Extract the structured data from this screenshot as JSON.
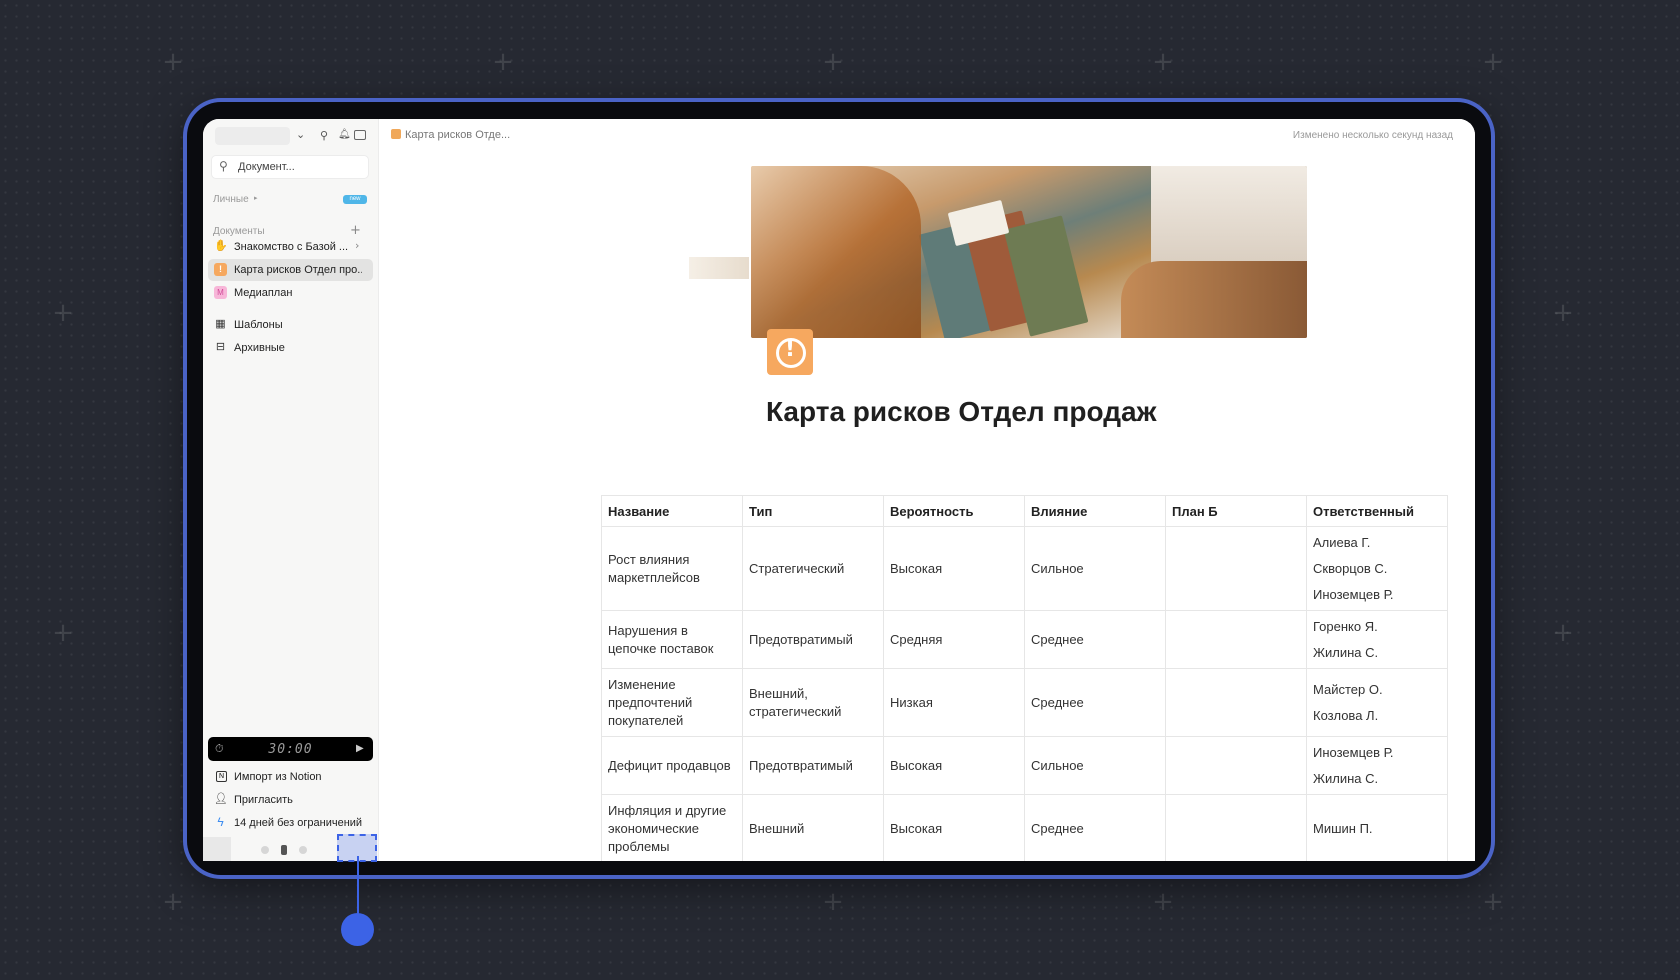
{
  "sidebar": {
    "search_placeholder": "Документ...",
    "personal_label": "Личные",
    "personal_badge": "new",
    "docs_label": "Документы",
    "items": [
      {
        "label": "Знакомство с Базой ...",
        "icon": "waving-hand-icon"
      },
      {
        "label": "Карта рисков Отдел про...",
        "icon": "alert-icon"
      },
      {
        "label": "Медиаплан",
        "icon": "m-letter-icon"
      }
    ],
    "templates_label": "Шаблоны",
    "archive_label": "Архивные",
    "timer": "30:00",
    "bottom_items": [
      {
        "label": "Импорт из Notion",
        "icon": "notion-icon"
      },
      {
        "label": "Пригласить",
        "icon": "add-user-icon"
      },
      {
        "label": "14 дней без ограничений",
        "icon": "lightning-icon"
      }
    ]
  },
  "page": {
    "breadcrumb": "Карта рисков Отде...",
    "edited": "Изменено несколько секунд назад",
    "title": "Карта рисков Отдел продаж",
    "accent": "#f6a85f"
  },
  "table": {
    "headers": [
      "Название",
      "Тип",
      "Вероятность",
      "Влияние",
      "План Б",
      "Ответственный"
    ],
    "rows": [
      {
        "name": "Рост влияния маркетплейсов",
        "type": "Стратегический",
        "prob": "Высокая",
        "impact": "Сильное",
        "plan": "",
        "owners": [
          "Алиева Г.",
          "Скворцов С.",
          "Иноземцев Р."
        ]
      },
      {
        "name": "Нарушения в цепочке поставок",
        "type": "Предотвратимый",
        "prob": "Средняя",
        "impact": "Среднее",
        "plan": "",
        "owners": [
          "Горенко Я.",
          "Жилина С."
        ]
      },
      {
        "name": "Изменение предпочтений покупателей",
        "type": "Внешний, стратегический",
        "prob": "Низкая",
        "impact": "Среднее",
        "plan": "",
        "owners": [
          "Майстер О.",
          "Козлова Л."
        ]
      },
      {
        "name": "Дефицит продавцов",
        "type": "Предотвратимый",
        "prob": "Высокая",
        "impact": "Сильное",
        "plan": "",
        "owners": [
          "Иноземцев Р.",
          "Жилина С."
        ]
      },
      {
        "name": "Инфляция и другие экономические проблемы",
        "type": "Внешний",
        "prob": "Высокая",
        "impact": "Среднее",
        "plan": "",
        "owners": [
          "Мишин П."
        ]
      }
    ]
  }
}
